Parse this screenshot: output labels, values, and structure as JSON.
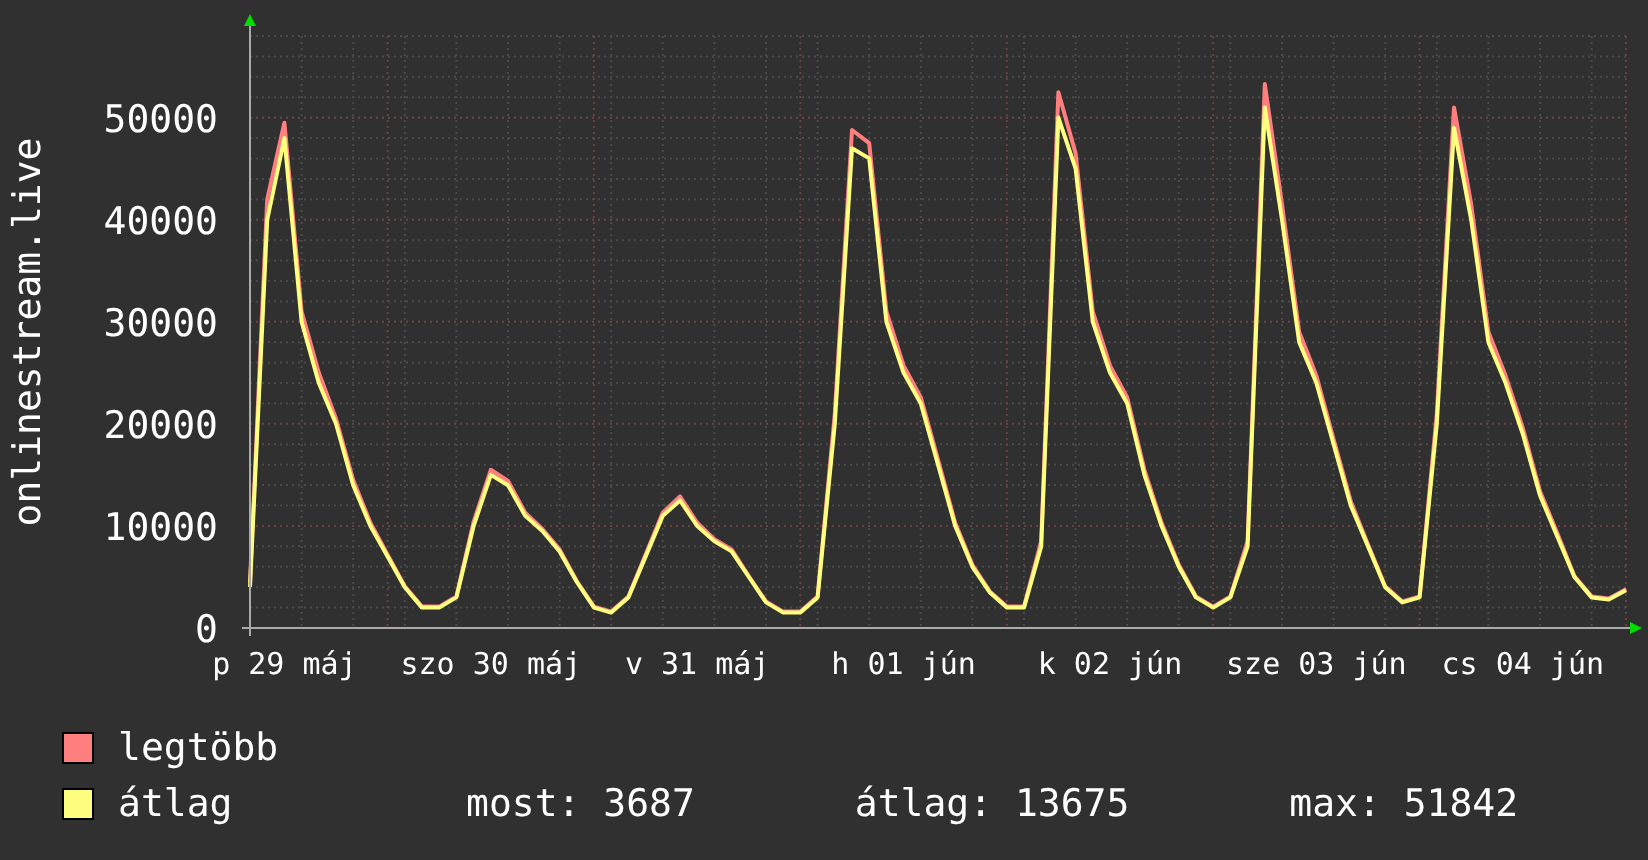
{
  "chart_data": {
    "type": "line",
    "ylabel": "onlinestream.live",
    "grid": true,
    "ylim": [
      0,
      58000
    ],
    "yticks": [
      0,
      10000,
      20000,
      30000,
      40000,
      50000
    ],
    "categories": [
      null,
      null,
      "p 29 máj",
      null,
      null,
      null,
      null,
      null,
      null,
      null,
      null,
      null,
      null,
      null,
      "szo 30 máj",
      null,
      null,
      null,
      null,
      null,
      null,
      null,
      null,
      null,
      null,
      null,
      "v 31 máj",
      null,
      null,
      null,
      null,
      null,
      null,
      null,
      null,
      null,
      null,
      null,
      "h 01 jún",
      null,
      null,
      null,
      null,
      null,
      null,
      null,
      null,
      null,
      null,
      null,
      "k 02 jún",
      null,
      null,
      null,
      null,
      null,
      null,
      null,
      null,
      null,
      null,
      null,
      "sze 03 jún",
      null,
      null,
      null,
      null,
      null,
      null,
      null,
      null,
      null,
      null,
      null,
      "cs 04 jún",
      null,
      null,
      null,
      null,
      null,
      null
    ],
    "series": [
      {
        "name": "legtöbb",
        "color": "#ff7f7f",
        "values": [
          4500,
          42000,
          49500,
          31000,
          25000,
          20500,
          14500,
          10300,
          7200,
          4100,
          2100,
          2100,
          3100,
          10400,
          15500,
          14400,
          11300,
          9700,
          7700,
          4600,
          2100,
          1600,
          3100,
          7200,
          11300,
          12900,
          10300,
          8700,
          7700,
          5100,
          2600,
          1600,
          1600,
          3100,
          21000,
          48800,
          47500,
          31000,
          25700,
          22600,
          16500,
          10300,
          6200,
          3600,
          2100,
          2100,
          8500,
          52500,
          46500,
          31000,
          25700,
          22600,
          15500,
          10300,
          6200,
          3100,
          2100,
          3100,
          8500,
          53300,
          41500,
          29000,
          24700,
          18500,
          12400,
          8200,
          4100,
          2600,
          3100,
          21000,
          51000,
          41500,
          29000,
          24700,
          19600,
          13400,
          9300,
          5100,
          3100,
          2900,
          3800
        ]
      },
      {
        "name": "átlag",
        "color": "#ffff7f",
        "values": [
          4000,
          40000,
          48000,
          30000,
          24000,
          20000,
          14000,
          10000,
          7000,
          4000,
          2000,
          2000,
          3000,
          10000,
          15000,
          14000,
          11000,
          9500,
          7500,
          4500,
          2000,
          1500,
          3000,
          7000,
          11000,
          12500,
          10000,
          8500,
          7500,
          5000,
          2500,
          1500,
          1500,
          3000,
          20000,
          47000,
          46000,
          30000,
          25000,
          22000,
          16000,
          10000,
          6000,
          3500,
          2000,
          2000,
          8000,
          50000,
          45000,
          30000,
          25000,
          22000,
          15000,
          10000,
          6000,
          3000,
          2000,
          3000,
          8000,
          51000,
          40000,
          28000,
          24000,
          18000,
          12000,
          8000,
          4000,
          2500,
          3000,
          20000,
          49000,
          40000,
          28000,
          24000,
          19000,
          13000,
          9000,
          5000,
          3000,
          2800,
          3700
        ]
      }
    ]
  },
  "stats": [
    "most: 3687",
    "átlag: 13675",
    "max: 51842"
  ]
}
